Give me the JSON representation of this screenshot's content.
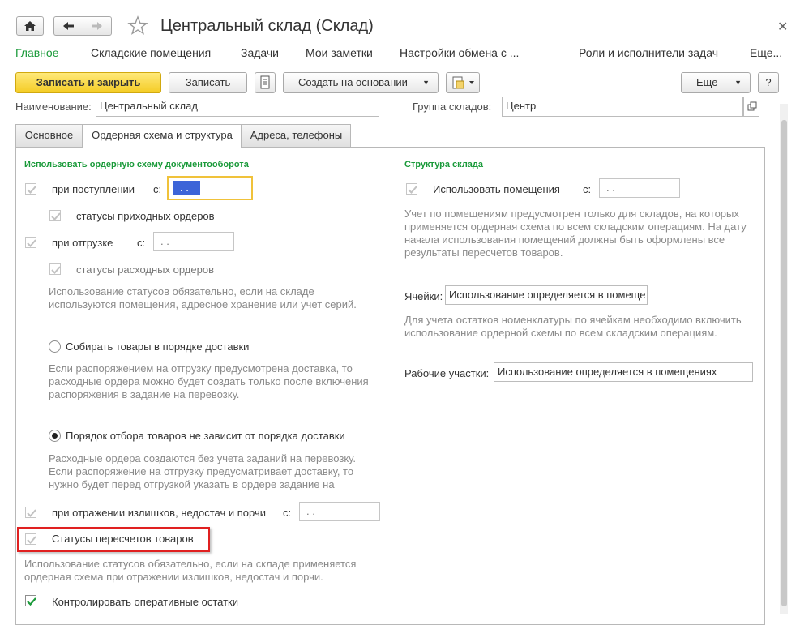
{
  "window": {
    "title": "Центральный склад (Склад)"
  },
  "nav": {
    "items": [
      {
        "label": "Главное",
        "active": true
      },
      {
        "label": "Складские помещения"
      },
      {
        "label": "Задачи"
      },
      {
        "label": "Мои заметки"
      },
      {
        "label": "Настройки обмена с ..."
      },
      {
        "label": "Роли и исполнители задач"
      },
      {
        "label": "Еще..."
      }
    ]
  },
  "toolbar": {
    "save_close": "Записать и закрыть",
    "save": "Записать",
    "create_based": "Создать на основании",
    "more": "Еще",
    "help": "?"
  },
  "header": {
    "name_label": "Наименование:",
    "name_value": "Центральный склад",
    "group_label": "Группа складов:",
    "group_value": "Центр"
  },
  "tabs": [
    {
      "label": "Основное"
    },
    {
      "label": "Ордерная схема и структура",
      "active": true
    },
    {
      "label": "Адреса, телефоны"
    }
  ],
  "left": {
    "section_title": "Использовать ордерную схему документооборота",
    "receipt_label": "при поступлении",
    "date_prefix_receipt": "с:",
    "receipt_date": ". .",
    "incoming_statuses": "статусы приходных ордеров",
    "shipment_label": "при отгрузке",
    "date_prefix_shipment": "с:",
    "shipment_date": ". .",
    "outgoing_statuses": "статусы расходных ордеров",
    "note1": "Использование статусов обязательно, если на складе используются помещения, адресное хранение или учет серий.",
    "radio1_label": "Собирать товары в порядке доставки",
    "note2": "Если распоряжением на отгрузку предусмотрена доставка, то расходные ордера можно будет создать только после включения распоряжения в задание на перевозку.",
    "radio2_label": "Порядок отбора товаров не зависит от порядка доставки",
    "note3": "Расходные ордера создаются без учета заданий на перевозку. Если распоряжение на отгрузку предусматривает доставку, то нужно будет перед отгрузкой указать в ордере задание на",
    "surplus_label": "при отражении излишков, недостач и порчи",
    "date_prefix_surplus": "с:",
    "surplus_date": ". .",
    "recount_statuses": "Статусы пересчетов товаров",
    "note4": "Использование статусов обязательно, если на складе применяется ордерная схема при отражении излишков, недостач и порчи.",
    "control_label": "Контролировать оперативные остатки"
  },
  "right": {
    "section_title": "Структура склада",
    "use_rooms_label": "Использовать помещения",
    "date_prefix_rooms": "с:",
    "rooms_date": ". .",
    "note1": "Учет по помещениям предусмотрен только для складов, на которых применяется ордерная схема по всем складским операциям. На дату начала использования помещений должны быть оформлены все результаты пересчетов товаров.",
    "cells_label": "Ячейки:",
    "cells_value": "Использование определяется в помеще",
    "note2": "Для учета остатков номенклатуры по ячейкам необходимо включить использование ордерной схемы по всем складским операциям.",
    "work_areas_label": "Рабочие участки:",
    "work_areas_value": "Использование определяется в помещениях"
  },
  "colors": {
    "accent_green": "#1a9a3a",
    "primary_button": "#f4cc25",
    "highlight_red": "#e02020",
    "selection_blue": "#3c64d8"
  }
}
